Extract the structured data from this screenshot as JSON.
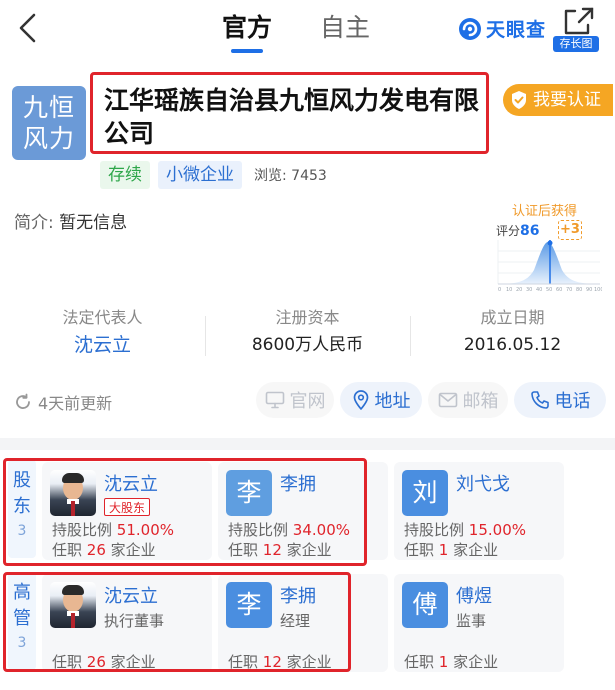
{
  "header": {
    "tabs": [
      {
        "label": "官方",
        "active": true
      },
      {
        "label": "自主",
        "active": false
      }
    ],
    "brand": "天眼查",
    "longshot_label": "存长图",
    "accent_color": "#1e6fe6",
    "highlight_color": "#e0242b"
  },
  "company": {
    "logo_text": "九恒风力",
    "name": "江华瑶族自治县九恒风力发电有限公司",
    "verify_label": "我要认证",
    "status_tag": "存续",
    "type_tag": "小微企业",
    "views_label": "浏览:",
    "views": "7453",
    "intro_label": "简介:",
    "intro_value": "暂无信息"
  },
  "score": {
    "title": "认证后获得",
    "label": "评分",
    "value": "86",
    "bonus": "+3"
  },
  "facts": [
    {
      "label": "法定代表人",
      "value": "沈云立"
    },
    {
      "label": "注册资本",
      "value": "8600万人民币"
    },
    {
      "label": "成立日期",
      "value": "2016.05.12"
    }
  ],
  "actions": {
    "updated": "4天前更新",
    "website": "官网",
    "address": "地址",
    "email": "邮箱",
    "phone": "电话"
  },
  "shareholders": {
    "label": "股东",
    "count": "3",
    "items": [
      {
        "name": "沈云立",
        "badge": "大股东",
        "ratio_label": "持股比例",
        "ratio": "51.00%",
        "jobs_prefix": "任职",
        "jobs": "26",
        "jobs_suffix": "家企业"
      },
      {
        "name": "李拥",
        "avatar": "李",
        "ratio_label": "持股比例",
        "ratio": "34.00%",
        "jobs_prefix": "任职",
        "jobs": "12",
        "jobs_suffix": "家企业"
      },
      {
        "name": "刘弋戈",
        "avatar": "刘",
        "ratio_label": "持股比例",
        "ratio": "15.00%",
        "jobs_prefix": "任职",
        "jobs": "1",
        "jobs_suffix": "家企业"
      }
    ]
  },
  "executives": {
    "label": "高管",
    "count": "3",
    "items": [
      {
        "name": "沈云立",
        "role": "执行董事",
        "jobs_prefix": "任职",
        "jobs": "26",
        "jobs_suffix": "家企业"
      },
      {
        "name": "李拥",
        "avatar": "李",
        "role": "经理",
        "jobs_prefix": "任职",
        "jobs": "12",
        "jobs_suffix": "家企业"
      },
      {
        "name": "傅煜",
        "avatar": "傅",
        "role": "监事",
        "jobs_prefix": "任职",
        "jobs": "1",
        "jobs_suffix": "家企业"
      }
    ]
  }
}
